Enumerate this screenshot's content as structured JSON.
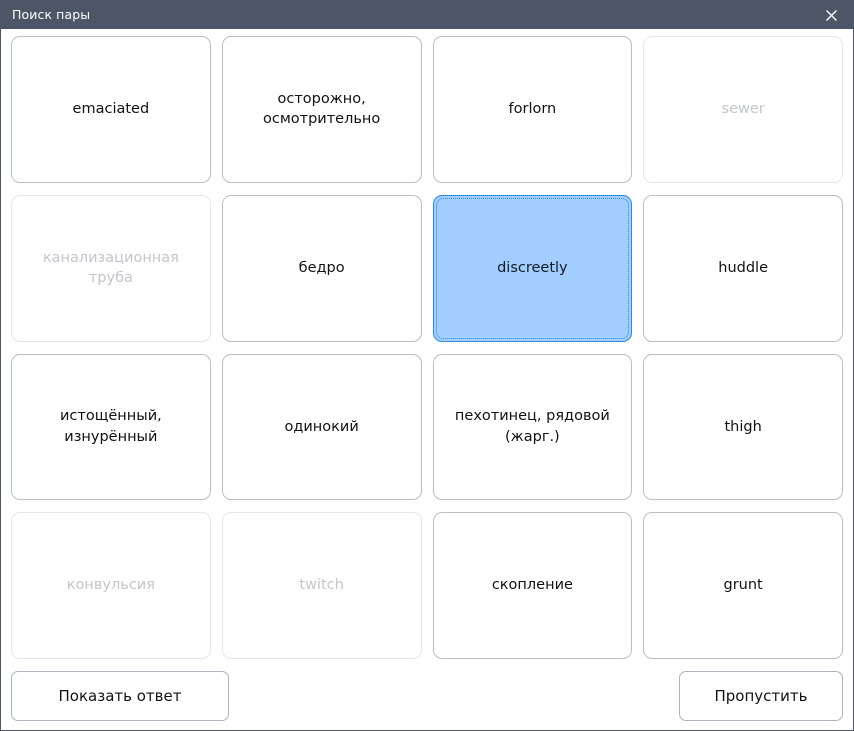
{
  "window": {
    "title": "Поиск пары",
    "close_icon": "close-icon",
    "titlebar_color": "#4d5666"
  },
  "colors": {
    "selected_fill": "#a3cdfc",
    "selected_border": "#2e8bdf",
    "card_border": "#b9bec7",
    "matched_border": "#e3e6ea",
    "matched_text": "#c2c6cc",
    "text": "#121212"
  },
  "grid": {
    "columns": 4,
    "rows": 4,
    "cards": [
      {
        "label": "emaciated",
        "state": "default"
      },
      {
        "label": "осторожно,\nосмотрительно",
        "state": "default"
      },
      {
        "label": "forlorn",
        "state": "default"
      },
      {
        "label": "sewer",
        "state": "matched"
      },
      {
        "label": "канализационная\nтруба",
        "state": "matched"
      },
      {
        "label": "бедро",
        "state": "default"
      },
      {
        "label": "discreetly",
        "state": "selected"
      },
      {
        "label": "huddle",
        "state": "default"
      },
      {
        "label": "истощённый,\nизнурённый",
        "state": "default"
      },
      {
        "label": "одинокий",
        "state": "default"
      },
      {
        "label": "пехотинец, рядовой\n(жарг.)",
        "state": "default"
      },
      {
        "label": "thigh",
        "state": "default"
      },
      {
        "label": "конвульсия",
        "state": "matched"
      },
      {
        "label": "twitch",
        "state": "matched"
      },
      {
        "label": "скопление",
        "state": "default"
      },
      {
        "label": "grunt",
        "state": "default"
      }
    ]
  },
  "footer": {
    "show_answer_label": "Показать ответ",
    "skip_label": "Пропустить"
  }
}
